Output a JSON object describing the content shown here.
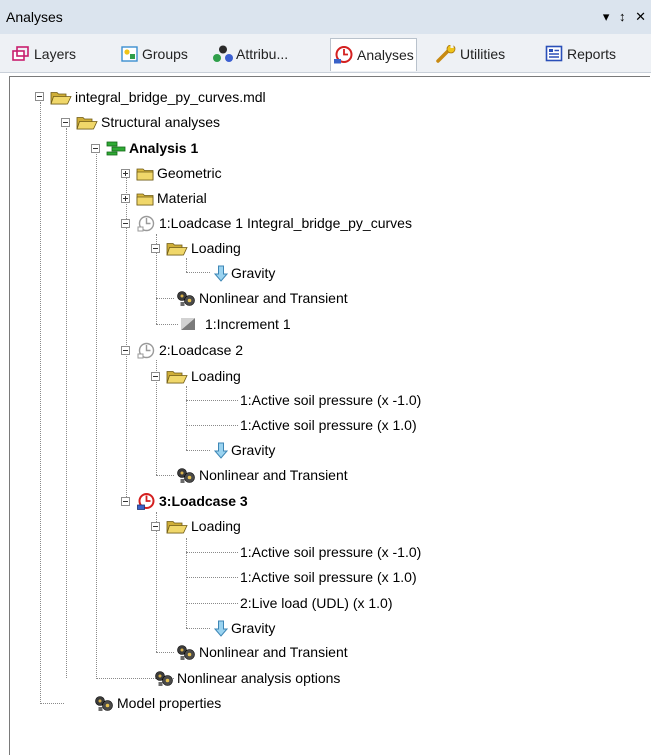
{
  "window": {
    "title": "Analyses",
    "controls": "▾ ↕ ✕"
  },
  "tabs": [
    {
      "label": "Layers"
    },
    {
      "label": "Groups"
    },
    {
      "label": "Attribu..."
    },
    {
      "label": "Analyses"
    },
    {
      "label": "Utilities"
    },
    {
      "label": "Reports"
    }
  ],
  "tree": {
    "model_file": "integral_bridge_py_curves.mdl",
    "structural_analyses": "Structural analyses",
    "analysis1": "Analysis 1",
    "geometric": "Geometric",
    "material": "Material",
    "lc1": {
      "label": "1:Loadcase 1 Integral_bridge_py_curves",
      "loading": "Loading",
      "gravity": "Gravity",
      "nonlinear": "Nonlinear and Transient",
      "increment": "1:Increment 1"
    },
    "lc2": {
      "label": "2:Loadcase 2",
      "loading": "Loading",
      "soil_neg": "1:Active soil pressure (x -1.0)",
      "soil_pos": "1:Active soil pressure (x 1.0)",
      "gravity": "Gravity",
      "nonlinear": "Nonlinear and Transient"
    },
    "lc3": {
      "label": "3:Loadcase 3",
      "loading": "Loading",
      "soil_neg": "1:Active soil pressure (x -1.0)",
      "soil_pos": "1:Active soil pressure (x 1.0)",
      "live_load": "2:Live load (UDL) (x 1.0)",
      "gravity": "Gravity",
      "nonlinear": "Nonlinear and Transient"
    },
    "nonlinear_options": "Nonlinear analysis options",
    "model_properties": "Model properties"
  },
  "colors": {
    "folder": "#e8c84a",
    "gravity_arrow": "#8ac6e8",
    "analysis_green": "#22a02a",
    "loadcase_active": "#d42020"
  }
}
